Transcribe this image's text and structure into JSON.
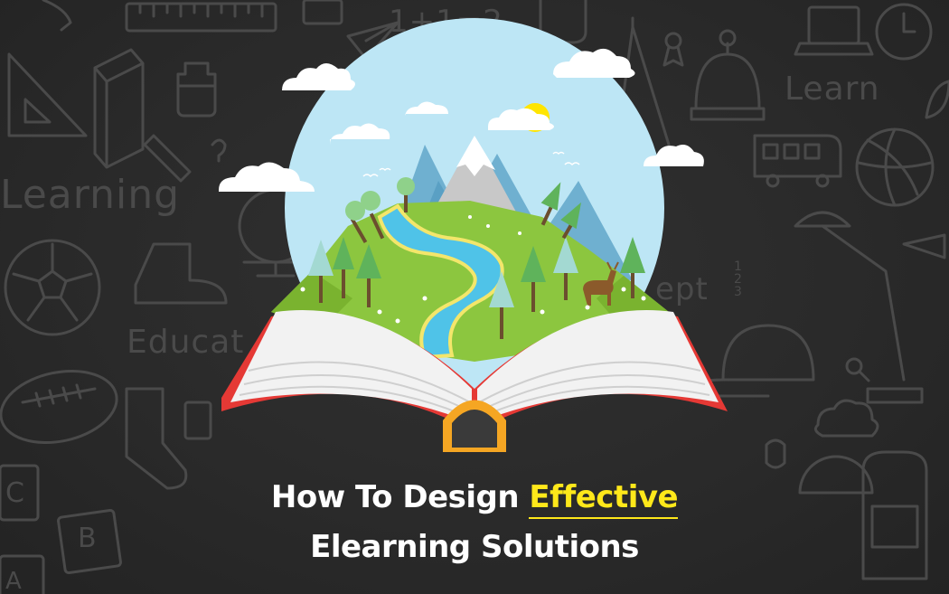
{
  "background": {
    "color": "#2a2a2a",
    "doodle_color": "#4a4a4a",
    "doodle_words": {
      "learning": "Learning",
      "learn": "Learn",
      "educat": "Educat",
      "math": "1+1=2",
      "ept": "ept",
      "c": "C",
      "b": "B",
      "a": "A",
      "frac_top": "1",
      "frac_mid": "2",
      "frac_bot": "3"
    }
  },
  "illustration": {
    "sky_color": "#bde6f5",
    "sun_color": "#ffe500",
    "hill_color": "#8cc63f",
    "river_color": "#4fc3e8",
    "book_cover_color": "#e53935",
    "page_color": "#f2f2f2"
  },
  "headline": {
    "line1_prefix": "How To Design ",
    "line1_accent": "Effective",
    "line2": "Elearning Solutions",
    "accent_color": "#ffe81a"
  }
}
